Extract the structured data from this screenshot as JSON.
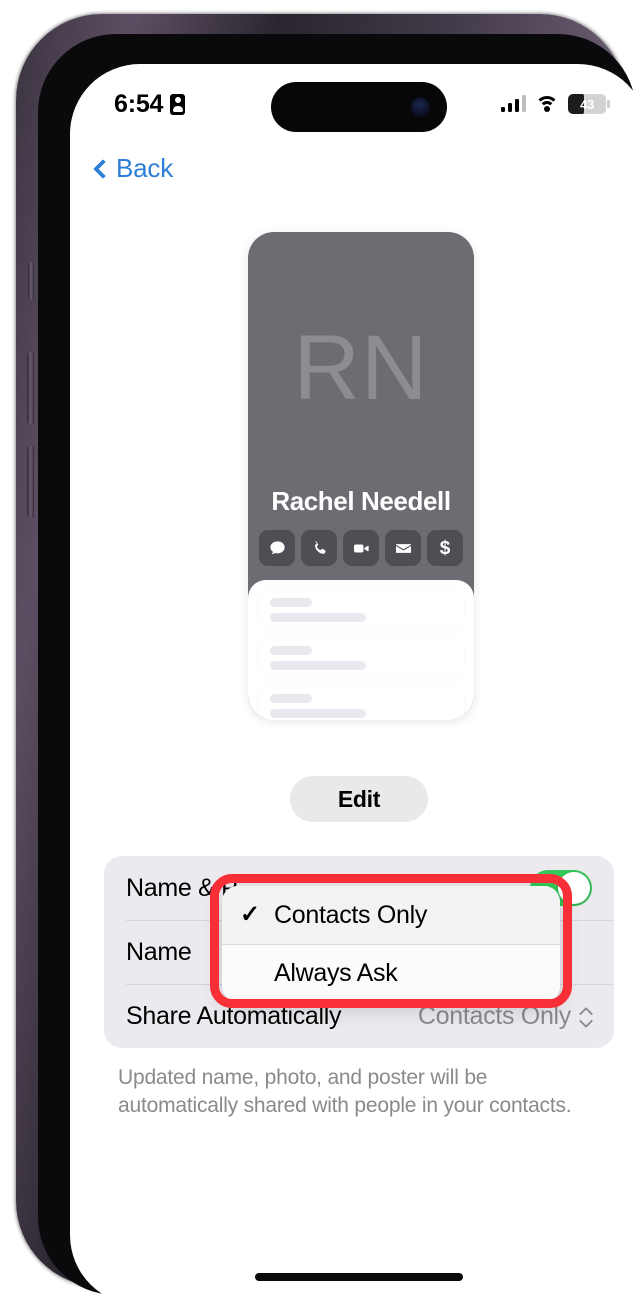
{
  "status_bar": {
    "time": "6:54",
    "time_icon": "contact-card-icon",
    "signal_icon": "cellular-signal-icon",
    "wifi_icon": "wifi-icon",
    "battery_level": "43",
    "battery_percent": 43
  },
  "nav": {
    "back_label": "Back",
    "back_icon": "chevron-left-icon"
  },
  "poster": {
    "initials": "RN",
    "name": "Rachel Needell",
    "actions": [
      {
        "name": "message",
        "icon": "message-bubble-icon"
      },
      {
        "name": "call",
        "icon": "phone-icon"
      },
      {
        "name": "facetime",
        "icon": "video-camera-icon"
      },
      {
        "name": "mail",
        "icon": "envelope-icon"
      },
      {
        "name": "payment",
        "icon": "dollar-sign-icon"
      }
    ],
    "placeholder_rows": 3
  },
  "edit": {
    "label": "Edit"
  },
  "settings": {
    "rows": [
      {
        "label": "Name & P",
        "value": "",
        "control": "toggle",
        "toggle_on": true
      },
      {
        "label": "Name",
        "value": "",
        "control": "none"
      },
      {
        "label": "Share Automatically",
        "value": "Contacts Only",
        "control": "stepper"
      }
    ]
  },
  "footer": {
    "note": "Updated name, photo, and poster will be automatically shared with people in your contacts."
  },
  "popup": {
    "items": [
      {
        "label": "Contacts Only",
        "checked": true,
        "check_glyph": "✓"
      },
      {
        "label": "Always Ask",
        "checked": false,
        "check_glyph": "✓"
      }
    ]
  },
  "colors": {
    "accent_blue": "#2f7fd8",
    "toggle_green": "#34c759",
    "highlight_red": "#f82f36",
    "poster_bg": "#6c6c72",
    "group_bg": "#eceaee"
  }
}
